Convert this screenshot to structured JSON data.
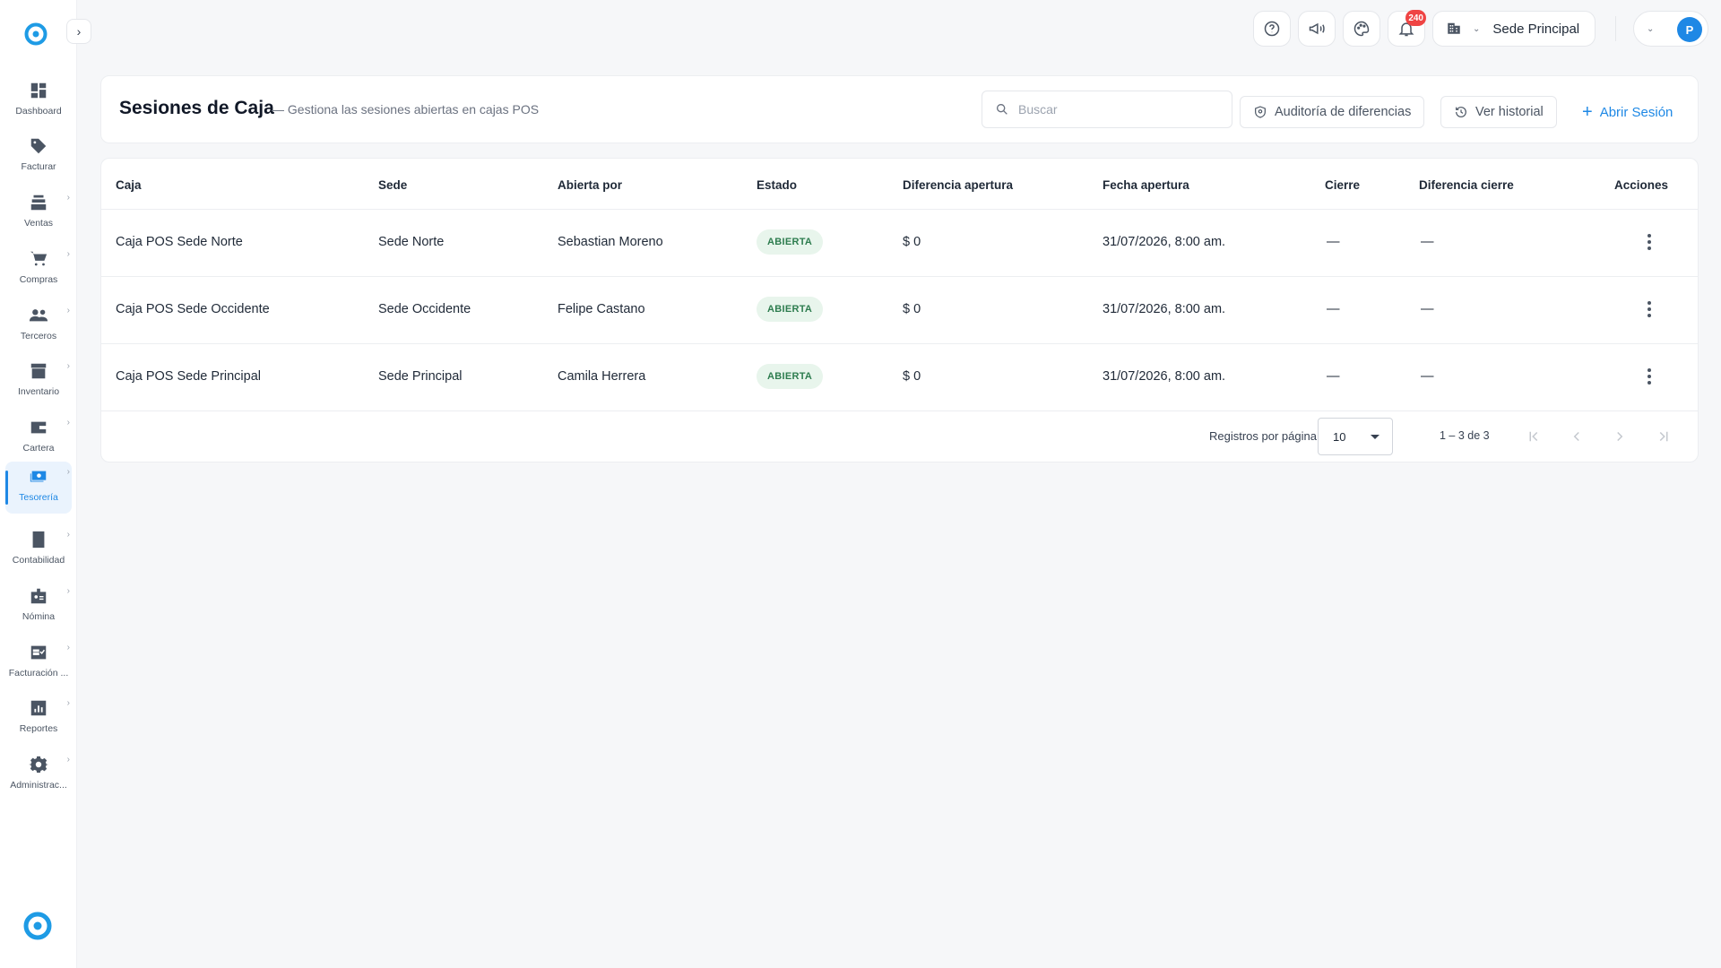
{
  "sidebar": {
    "items": [
      {
        "label": "Dashboard",
        "icon": "dashboard-icon",
        "has_submenu": false,
        "active": false
      },
      {
        "label": "Facturar",
        "icon": "tag-icon",
        "has_submenu": false,
        "active": false
      },
      {
        "label": "Ventas",
        "icon": "cash-register-icon",
        "has_submenu": true,
        "active": false
      },
      {
        "label": "Compras",
        "icon": "cart-icon",
        "has_submenu": true,
        "active": false
      },
      {
        "label": "Terceros",
        "icon": "people-icon",
        "has_submenu": true,
        "active": false
      },
      {
        "label": "Inventario",
        "icon": "archive-icon",
        "has_submenu": true,
        "active": false
      },
      {
        "label": "Cartera",
        "icon": "wallet-icon",
        "has_submenu": true,
        "active": false
      },
      {
        "label": "Tesorería",
        "icon": "money-icon",
        "has_submenu": true,
        "active": true
      },
      {
        "label": "Contabilidad",
        "icon": "ledger-icon",
        "has_submenu": true,
        "active": false
      },
      {
        "label": "Nómina",
        "icon": "badge-icon",
        "has_submenu": true,
        "active": false
      },
      {
        "label": "Facturación ...",
        "icon": "invoice-check-icon",
        "has_submenu": true,
        "active": false
      },
      {
        "label": "Reportes",
        "icon": "bar-chart-icon",
        "has_submenu": true,
        "active": false
      },
      {
        "label": "Administrac...",
        "icon": "gear-icon",
        "has_submenu": true,
        "active": false
      }
    ]
  },
  "topbar": {
    "notifications_count": "240",
    "sede": "Sede Principal",
    "avatar_initial": "P"
  },
  "header": {
    "title": "Sesiones de Caja",
    "subtitle": "— Gestiona las sesiones abiertas en cajas POS",
    "search_placeholder": "Buscar",
    "audit_button": "Auditoría de diferencias",
    "history_button": "Ver historial",
    "open_session_button": "Abrir Sesión"
  },
  "table": {
    "columns": [
      "Caja",
      "Sede",
      "Abierta por",
      "Estado",
      "Diferencia apertura",
      "Fecha apertura",
      "Cierre",
      "Diferencia cierre",
      "Acciones"
    ],
    "rows": [
      {
        "caja": "Caja POS Sede Norte",
        "sede": "Sede Norte",
        "abierta_por": "Sebastian Moreno",
        "estado": "ABIERTA",
        "dif_apertura": "$ 0",
        "fecha": "31/07/2026, 8:00 am.",
        "cierre": "—",
        "dif_cierre": "—"
      },
      {
        "caja": "Caja POS Sede Occidente",
        "sede": "Sede Occidente",
        "abierta_por": "Felipe Castano",
        "estado": "ABIERTA",
        "dif_apertura": "$ 0",
        "fecha": "31/07/2026, 8:00 am.",
        "cierre": "—",
        "dif_cierre": "—"
      },
      {
        "caja": "Caja POS Sede Principal",
        "sede": "Sede Principal",
        "abierta_por": "Camila Herrera",
        "estado": "ABIERTA",
        "dif_apertura": "$ 0",
        "fecha": "31/07/2026, 8:00 am.",
        "cierre": "—",
        "dif_cierre": "—"
      }
    ]
  },
  "pagination": {
    "rows_per_page_label": "Registros por página",
    "rows_per_page_value": "10",
    "range": "1 – 3 de 3"
  },
  "colors": {
    "accent": "#1e88e5",
    "status_bg": "#e8f5ec",
    "status_text": "#2e7d4f",
    "badge": "#ef4444"
  }
}
